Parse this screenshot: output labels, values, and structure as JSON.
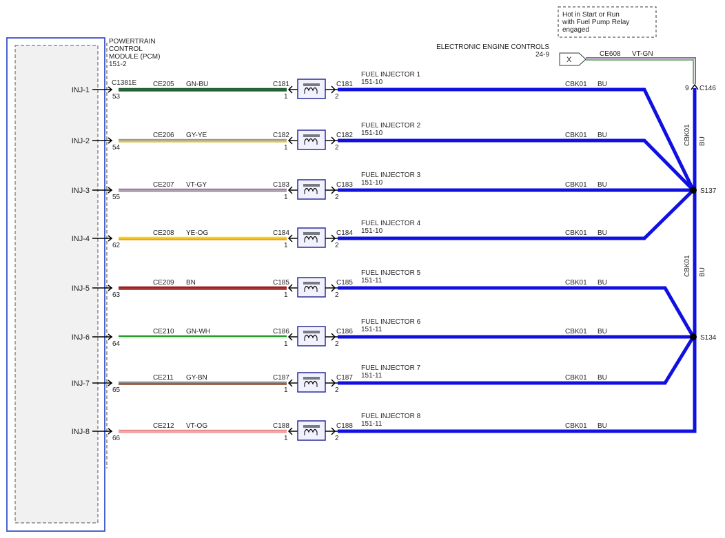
{
  "module": {
    "name_line1": "POWERTRAIN",
    "name_line2": "CONTROL",
    "name_line3": "MODULE (PCM)",
    "ref": "151-2",
    "connector": "C1381E"
  },
  "note": {
    "line1": "Hot in Start or Run",
    "line2": "with Fuel Pump Relay",
    "line3": "engaged"
  },
  "eec": {
    "title": "ELECTRONIC ENGINE CONTROLS",
    "ref": "24-9"
  },
  "source": {
    "symbol": "X",
    "circuit": "CE608",
    "color": "VT-GN",
    "pin": "9",
    "connector": "C146"
  },
  "splices": {
    "upper": "S137",
    "lower": "S134"
  },
  "vertical_wires": [
    {
      "circuit": "CBK01",
      "color": "BU"
    },
    {
      "circuit": "CBK01",
      "color": "BU"
    }
  ],
  "colors": {
    "module_border": "#3a50c8",
    "injector_box": "#2a2a9a",
    "bus_blue": "#1010e0",
    "source_wire_a": "#8a6a9a",
    "source_wire_b": "#7ab07a"
  },
  "injectors": [
    {
      "pcm_pin_label": "INJ-1",
      "pcm_pin": "53",
      "circuit": "CE205",
      "color_code": "GN-BU",
      "wire_colors": [
        "#1f5e33",
        "#1f5e33"
      ],
      "conn": "C181",
      "pin1": "1",
      "pin2": "2",
      "name": "FUEL INJECTOR 1",
      "ref": "151-10",
      "out_circuit": "CBK01",
      "out_color": "BU"
    },
    {
      "pcm_pin_label": "INJ-2",
      "pcm_pin": "54",
      "circuit": "CE206",
      "color_code": "GY-YE",
      "wire_colors": [
        "#999999",
        "#d8c84a"
      ],
      "conn": "C182",
      "pin1": "1",
      "pin2": "2",
      "name": "FUEL INJECTOR 2",
      "ref": "151-10",
      "out_circuit": "CBK01",
      "out_color": "BU"
    },
    {
      "pcm_pin_label": "INJ-3",
      "pcm_pin": "55",
      "circuit": "CE207",
      "color_code": "VT-GY",
      "wire_colors": [
        "#b070c0",
        "#a0a0a0"
      ],
      "conn": "C183",
      "pin1": "1",
      "pin2": "2",
      "name": "FUEL INJECTOR 3",
      "ref": "151-10",
      "out_circuit": "CBK01",
      "out_color": "BU"
    },
    {
      "pcm_pin_label": "INJ-4",
      "pcm_pin": "62",
      "circuit": "CE208",
      "color_code": "YE-OG",
      "wire_colors": [
        "#f0e000",
        "#f0a020"
      ],
      "conn": "C184",
      "pin1": "1",
      "pin2": "2",
      "name": "FUEL INJECTOR 4",
      "ref": "151-10",
      "out_circuit": "CBK01",
      "out_color": "BU"
    },
    {
      "pcm_pin_label": "INJ-5",
      "pcm_pin": "63",
      "circuit": "CE209",
      "color_code": "BN",
      "wire_colors": [
        "#a02020",
        "#a02020"
      ],
      "conn": "C185",
      "pin1": "1",
      "pin2": "2",
      "name": "FUEL INJECTOR 5",
      "ref": "151-11",
      "out_circuit": "CBK01",
      "out_color": "BU"
    },
    {
      "pcm_pin_label": "INJ-6",
      "pcm_pin": "64",
      "circuit": "CE210",
      "color_code": "GN-WH",
      "wire_colors": [
        "#2a9a2a",
        "#e8f0e8"
      ],
      "conn": "C186",
      "pin1": "1",
      "pin2": "2",
      "name": "FUEL INJECTOR 6",
      "ref": "151-11",
      "out_circuit": "CBK01",
      "out_color": "BU"
    },
    {
      "pcm_pin_label": "INJ-7",
      "pcm_pin": "65",
      "circuit": "CE211",
      "color_code": "GY-BN",
      "wire_colors": [
        "#909090",
        "#8a4a2a"
      ],
      "conn": "C187",
      "pin1": "1",
      "pin2": "2",
      "name": "FUEL INJECTOR 7",
      "ref": "151-11",
      "out_circuit": "CBK01",
      "out_color": "BU"
    },
    {
      "pcm_pin_label": "INJ-8",
      "pcm_pin": "66",
      "circuit": "CE212",
      "color_code": "VT-OG",
      "wire_colors": [
        "#e89090",
        "#f0a0a0"
      ],
      "conn": "C188",
      "pin1": "1",
      "pin2": "2",
      "name": "FUEL INJECTOR 8",
      "ref": "151-11",
      "out_circuit": "CBK01",
      "out_color": "BU"
    }
  ]
}
